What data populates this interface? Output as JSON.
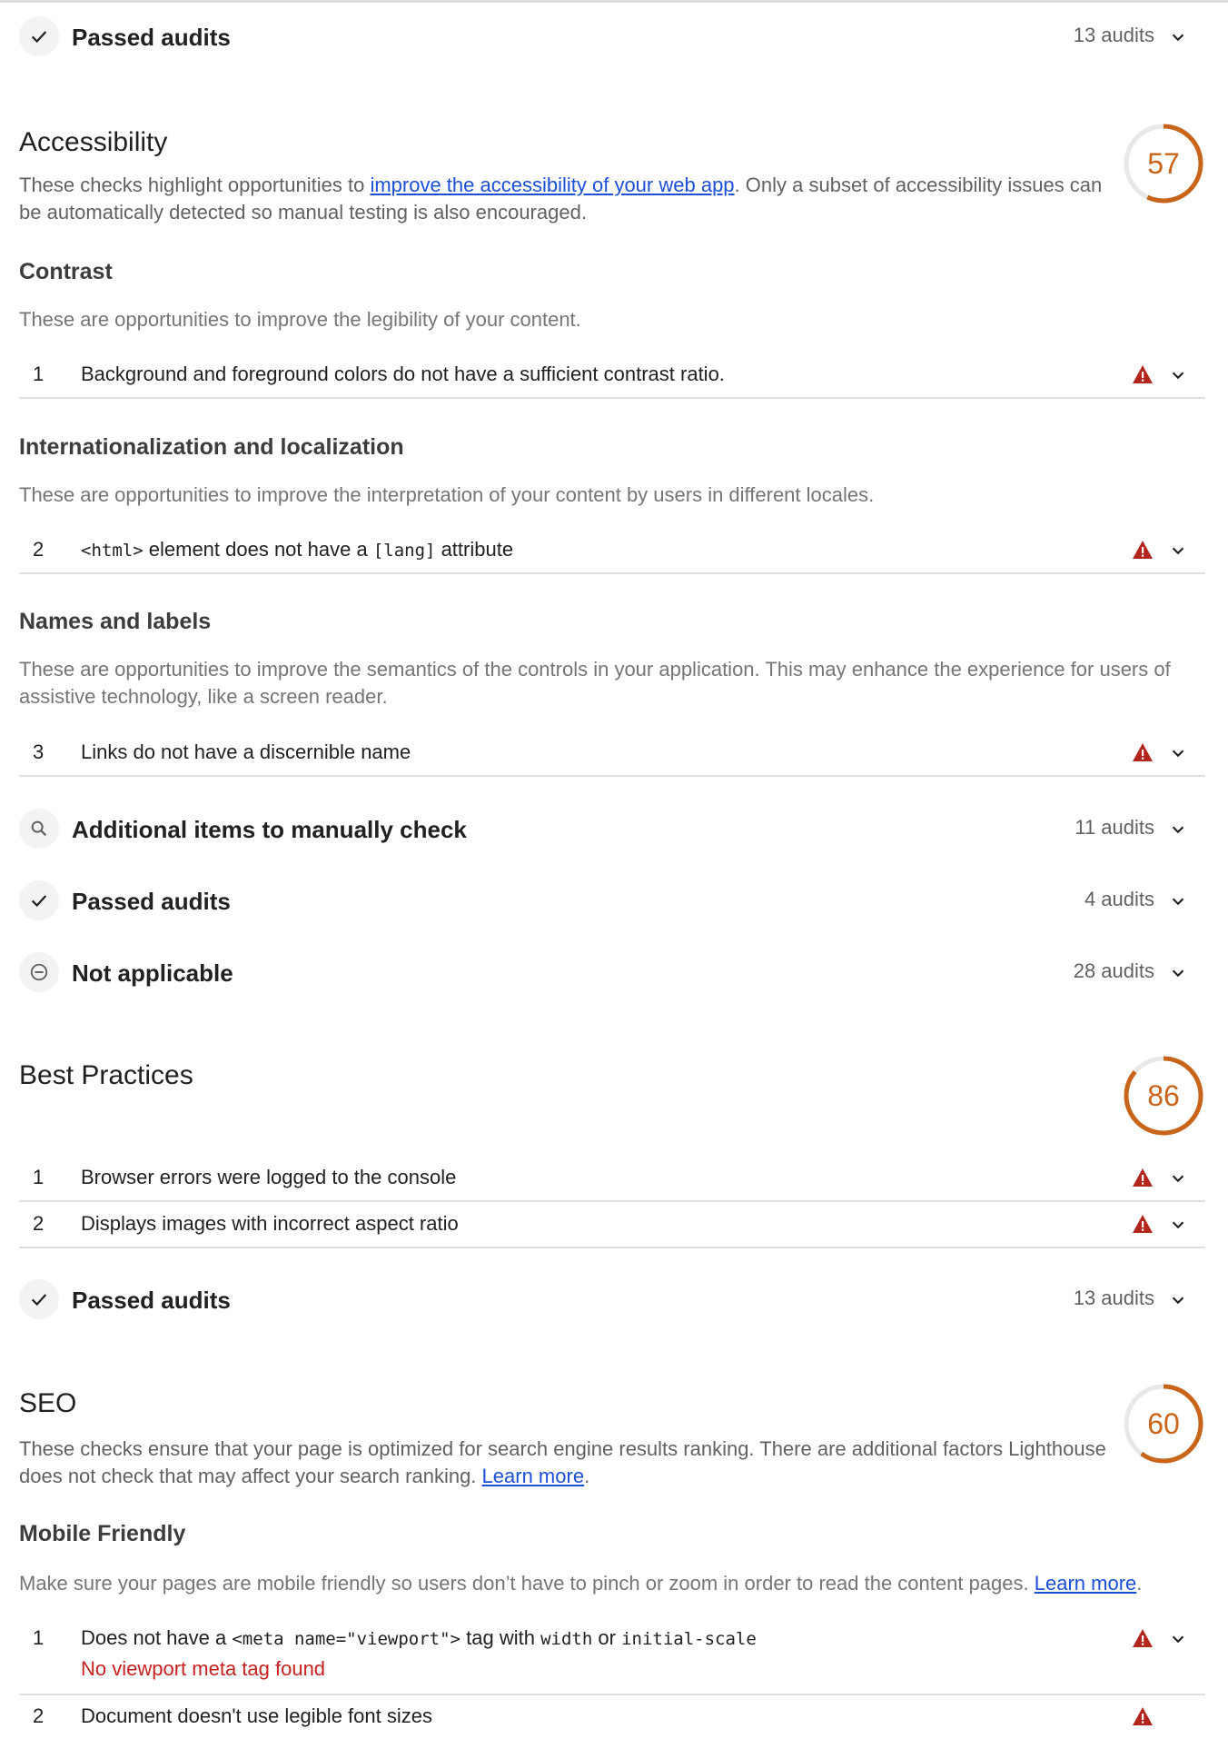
{
  "colors": {
    "gauge_average": "#c8651a",
    "fail_red": "#b3261e",
    "link_blue": "#1a4fd6",
    "icon_bg": "#f1f3f4"
  },
  "groups": {
    "perf_passed": {
      "title": "Passed audits",
      "count": "13 audits",
      "icon": "check-icon"
    },
    "a11y_manual": {
      "title": "Additional items to manually check",
      "count": "11 audits",
      "icon": "search-icon"
    },
    "a11y_passed": {
      "title": "Passed audits",
      "count": "4 audits",
      "icon": "check-icon"
    },
    "a11y_na": {
      "title": "Not applicable",
      "count": "28 audits",
      "icon": "minus-circle-icon"
    },
    "bp_passed": {
      "title": "Passed audits",
      "count": "13 audits",
      "icon": "check-icon"
    }
  },
  "accessibility": {
    "title": "Accessibility",
    "score": "57",
    "score_fraction": 0.57,
    "desc_before": "These checks highlight opportunities to ",
    "desc_link": "improve the accessibility of your web app",
    "desc_after": ". Only a subset of accessibility issues can be automatically detected so manual testing is also encouraged.",
    "contrast": {
      "title": "Contrast",
      "desc": "These are opportunities to improve the legibility of your content.",
      "audits": [
        {
          "num": "1",
          "text": "Background and foreground colors do not have a sufficient contrast ratio."
        }
      ]
    },
    "i18n": {
      "title": "Internationalization and localization",
      "desc": "These are opportunities to improve the interpretation of your content by users in different locales.",
      "audit": {
        "num": "2",
        "code1": "<html>",
        "mid": " element does not have a ",
        "code2": "[lang]",
        "end": " attribute"
      }
    },
    "names": {
      "title": "Names and labels",
      "desc": "These are opportunities to improve the semantics of the controls in your application. This may enhance the experience for users of assistive technology, like a screen reader.",
      "audits": [
        {
          "num": "3",
          "text": "Links do not have a discernible name"
        }
      ]
    }
  },
  "best_practices": {
    "title": "Best Practices",
    "score": "86",
    "score_fraction": 0.86,
    "audits": [
      {
        "num": "1",
        "text": "Browser errors were logged to the console"
      },
      {
        "num": "2",
        "text": "Displays images with incorrect aspect ratio"
      }
    ]
  },
  "seo": {
    "title": "SEO",
    "score": "60",
    "score_fraction": 0.6,
    "desc_before": "These checks ensure that your page is optimized for search engine results ranking. There are additional factors Lighthouse does not check that may affect your search ranking. ",
    "desc_link": "Learn more",
    "desc_after": ".",
    "mobile": {
      "title": "Mobile Friendly",
      "desc_before": "Make sure your pages are mobile friendly so users don’t have to pinch or zoom in order to read the content pages. ",
      "desc_link": "Learn more",
      "desc_after": ".",
      "audit1": {
        "num": "1",
        "t1": "Does not have a ",
        "code1": "<meta name=\"viewport\">",
        "t2": " tag with ",
        "code2": "width",
        "t3": " or ",
        "code3": "initial-scale",
        "sub": "No viewport meta tag found"
      },
      "audit2": {
        "num": "2",
        "text": "Document doesn't use legible font sizes"
      }
    }
  }
}
